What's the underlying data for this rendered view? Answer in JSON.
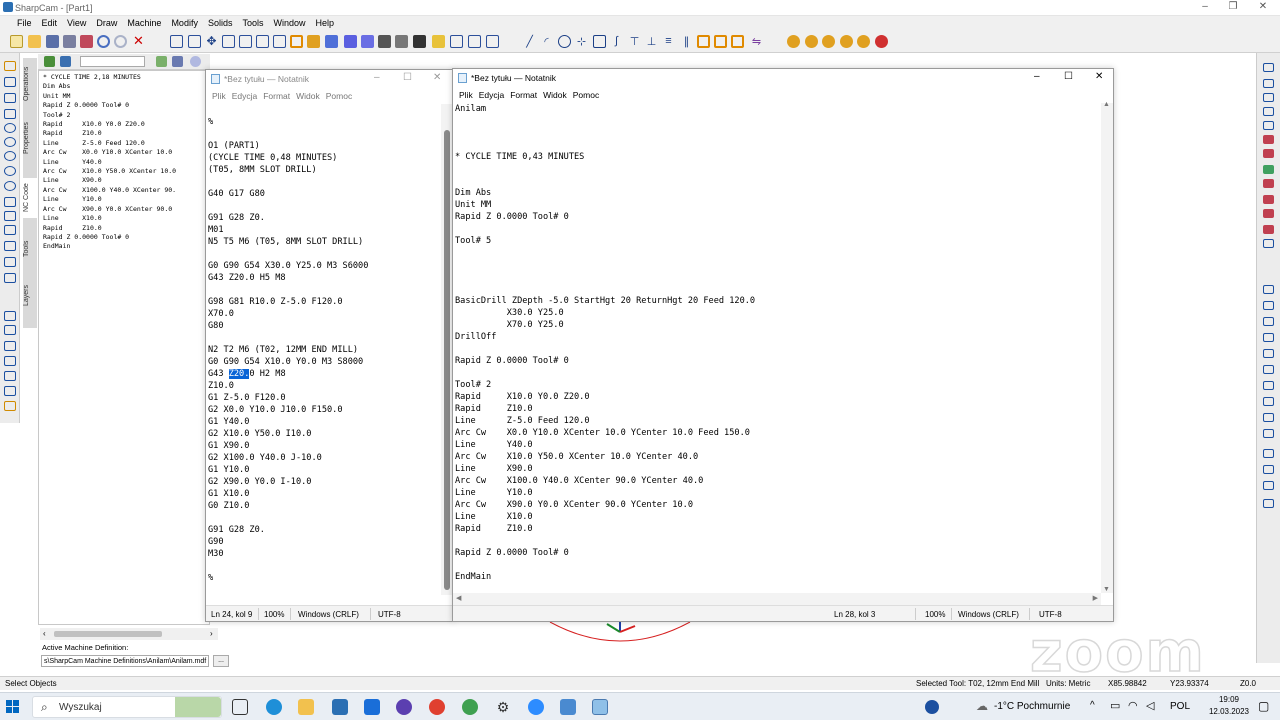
{
  "app": {
    "title": "SharpCam - [Part1]",
    "menu": [
      "File",
      "Edit",
      "View",
      "Draw",
      "Machine",
      "Modify",
      "Solids",
      "Tools",
      "Window",
      "Help"
    ],
    "window_controls": [
      "–",
      "❐",
      "✕"
    ],
    "side_tabs": [
      "Operations",
      "Properties",
      "NC Code",
      "Tools",
      "Layers"
    ],
    "nc_code_lines": [
      "* CYCLE TIME 2,18 MINUTES",
      "Dim Abs",
      "Unit MM",
      "Rapid Z 0.0000 Tool# 0",
      "Tool# 2",
      "Rapid     X10.0 Y0.0 Z20.0",
      "Rapid     Z10.0",
      "Line      Z-5.0 Feed 120.0",
      "Arc Cw    X0.0 Y10.0 XCenter 10.0",
      "Line      Y40.0",
      "Arc Cw    X10.0 Y50.0 XCenter 10.0",
      "Line      X90.0",
      "Arc Cw    X100.0 Y40.0 XCenter 90.",
      "Line      Y10.0",
      "Arc Cw    X90.0 Y0.0 XCenter 90.0",
      "Line      X10.0",
      "Rapid     Z10.0",
      "Rapid Z 0.0000 Tool# 0",
      "EndMain"
    ],
    "active_machine_label": "Active Machine Definition:",
    "active_machine_path": "s\\SharpCam Machine Definitions\\Anilam\\Anilam.mdf",
    "browse_button": "...",
    "status": {
      "left": "Select Objects",
      "selected_tool": "Selected Tool: T02, 12mm End Mill",
      "units": "Units: Metric",
      "x": "X85.98842",
      "y": "Y23.93374",
      "z": "Z0.0"
    }
  },
  "notepad_left": {
    "title": "*Bez tytułu — Notatnik",
    "menu": [
      "Plik",
      "Edycja",
      "Format",
      "Widok",
      "Pomoc"
    ],
    "lines": [
      "",
      "%",
      "",
      "O1 (PART1)",
      "(CYCLE TIME 0,48 MINUTES)",
      "(T05, 8MM SLOT DRILL)",
      "",
      "G40 G17 G80",
      "",
      "G91 G28 Z0.",
      "M01",
      "N5 T5 M6 (T05, 8MM SLOT DRILL)",
      "",
      "G0 G90 G54 X30.0 Y25.0 M3 S6000",
      "G43 Z20.0 H5 M8",
      "",
      "G98 G81 R10.0 Z-5.0 F120.0",
      "X70.0",
      "G80",
      "",
      "N2 T2 M6 (T02, 12MM END MILL)",
      "G0 G90 G54 X10.0 Y0.0 M3 S8000",
      "G43 Z20.0 H2 M8",
      "Z10.0",
      "G1 Z-5.0 F120.0",
      "G2 X0.0 Y10.0 J10.0 F150.0",
      "G1 Y40.0",
      "G2 X10.0 Y50.0 I10.0",
      "G1 X90.0",
      "G2 X100.0 Y40.0 J-10.0",
      "G1 Y10.0",
      "G2 X90.0 Y0.0 I-10.0",
      "G1 X10.0",
      "G0 Z10.0",
      "",
      "G91 G28 Z0.",
      "G90",
      "M30",
      "",
      "%"
    ],
    "highlight_line_prefix": "G43 ",
    "highlight_text": "Z20.",
    "highlight_line_suffix": "0 H2 M8",
    "status": {
      "pos": "Ln 24, kol 9",
      "zoom": "100%",
      "eol": "Windows (CRLF)",
      "enc": "UTF-8"
    }
  },
  "notepad_right": {
    "title": "*Bez tytułu — Notatnik",
    "menu": [
      "Plik",
      "Edycja",
      "Format",
      "Widok",
      "Pomoc"
    ],
    "lines": [
      "Anilam",
      "",
      "",
      "",
      "* CYCLE TIME 0,43 MINUTES",
      "",
      "",
      "Dim Abs",
      "Unit MM",
      "Rapid Z 0.0000 Tool# 0",
      "",
      "Tool# 5",
      "",
      "",
      "",
      "",
      "BasicDrill ZDepth -5.0 StartHgt 20 ReturnHgt 20 Feed 120.0",
      "          X30.0 Y25.0",
      "          X70.0 Y25.0",
      "DrillOff",
      "",
      "Rapid Z 0.0000 Tool# 0",
      "",
      "Tool# 2",
      "Rapid     X10.0 Y0.0 Z20.0",
      "Rapid     Z10.0",
      "Line      Z-5.0 Feed 120.0",
      "Arc Cw    X0.0 Y10.0 XCenter 10.0 YCenter 10.0 Feed 150.0",
      "Line      Y40.0",
      "Arc Cw    X10.0 Y50.0 XCenter 10.0 YCenter 40.0",
      "Line      X90.0",
      "Arc Cw    X100.0 Y40.0 XCenter 90.0 YCenter 40.0",
      "Line      Y10.0",
      "Arc Cw    X90.0 Y0.0 XCenter 90.0 YCenter 10.0",
      "Line      X10.0",
      "Rapid     Z10.0",
      "",
      "Rapid Z 0.0000 Tool# 0",
      "",
      "EndMain"
    ],
    "status": {
      "pos": "Ln 28, kol 3",
      "zoom": "100%",
      "eol": "Windows (CRLF)",
      "enc": "UTF-8"
    }
  },
  "watermark": "zoom",
  "taskbar": {
    "search_placeholder": "Wyszukaj",
    "weather": "-1°C Pochmurnie",
    "language": "POL",
    "time": "19:09",
    "date": "12.03.2023"
  },
  "colors": {
    "selection": "#0a64d6",
    "accent": "#0067c0",
    "toolpath": "#d62020"
  }
}
